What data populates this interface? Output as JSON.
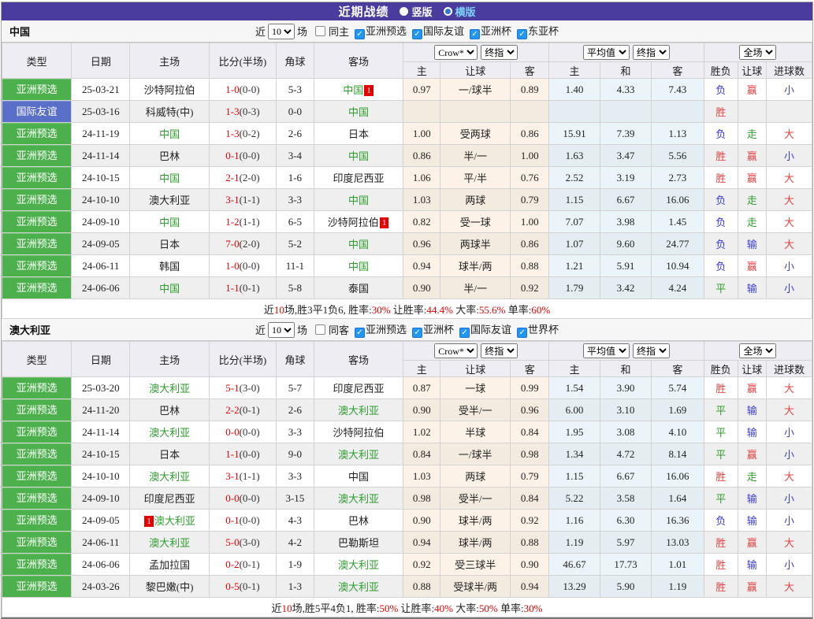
{
  "title_bar": {
    "title": "近期战绩",
    "radios": [
      {
        "label": "竖版",
        "selected": true,
        "label_color": "#ffffff"
      },
      {
        "label": "横版",
        "selected": false,
        "label_color": "#7fd2ff"
      }
    ]
  },
  "columns": {
    "type": "类型",
    "date": "日期",
    "home": "主场",
    "score": "比分(半场)",
    "corner": "角球",
    "away": "客场",
    "crow_select": "Crow*",
    "final_select": "终指",
    "avg_select": "平均值",
    "full_select": "全场",
    "sub": {
      "home": "主",
      "handicap": "让球",
      "away": "客",
      "avg_home": "主",
      "draw": "和",
      "avg_away": "客",
      "result": "胜负",
      "handicap_result": "让球",
      "goals": "进球数"
    }
  },
  "filter": {
    "near": "近",
    "count": "10",
    "games": "场"
  },
  "colors": {
    "accent_purple": "#4a3c9e",
    "badge_green": "#4cb14c",
    "badge_blue": "#5a6fc8",
    "team_green": "#2e9e2e",
    "score_red": "#e60000",
    "checkbox_blue": "#2196f3",
    "crow_col_bg": "#fcf2e7",
    "avg_col_bg": "#eaf4f9"
  },
  "sections": [
    {
      "name": "中国",
      "same_label": "同主",
      "checkboxes": [
        {
          "label": "亚洲预选",
          "checked": true
        },
        {
          "label": "国际友谊",
          "checked": true
        },
        {
          "label": "亚洲杯",
          "checked": true
        },
        {
          "label": "东亚杯",
          "checked": true
        }
      ],
      "rows": [
        {
          "type": {
            "label": "亚洲预选",
            "cls": "green"
          },
          "date": "25-03-21",
          "home": {
            "name": "沙特阿拉伯"
          },
          "score": "1-0",
          "half": "(0-0)",
          "corner": "5-3",
          "away": {
            "name": "中国",
            "green": true,
            "badge": "1",
            "badge_pos": "after"
          },
          "crow": [
            "0.97",
            "一/球半",
            "0.89"
          ],
          "avg": [
            "1.40",
            "4.33",
            "7.43"
          ],
          "result": [
            {
              "t": "负",
              "c": "blue"
            },
            {
              "t": "赢",
              "c": "red"
            },
            {
              "t": "小",
              "c": "blue"
            }
          ]
        },
        {
          "type": {
            "label": "国际友谊",
            "cls": "blue"
          },
          "date": "25-03-16",
          "home": {
            "name": "科威特(中)"
          },
          "score": "1-3",
          "half": "(0-3)",
          "corner": "0-0",
          "away": {
            "name": "中国",
            "green": true
          },
          "crow": [
            "",
            "",
            ""
          ],
          "avg": [
            "",
            "",
            ""
          ],
          "result": [
            {
              "t": "胜",
              "c": "red"
            },
            {
              "t": "",
              "c": ""
            },
            {
              "t": "",
              "c": ""
            }
          ]
        },
        {
          "type": {
            "label": "亚洲预选",
            "cls": "green"
          },
          "date": "24-11-19",
          "home": {
            "name": "中国",
            "green": true
          },
          "score": "1-3",
          "half": "(0-2)",
          "corner": "2-6",
          "away": {
            "name": "日本"
          },
          "crow": [
            "1.00",
            "受两球",
            "0.86"
          ],
          "avg": [
            "15.91",
            "7.39",
            "1.13"
          ],
          "result": [
            {
              "t": "负",
              "c": "blue"
            },
            {
              "t": "走",
              "c": "green"
            },
            {
              "t": "大",
              "c": "red"
            }
          ]
        },
        {
          "type": {
            "label": "亚洲预选",
            "cls": "green"
          },
          "date": "24-11-14",
          "home": {
            "name": "巴林"
          },
          "score": "0-1",
          "half": "(0-0)",
          "corner": "3-4",
          "away": {
            "name": "中国",
            "green": true
          },
          "crow": [
            "0.86",
            "半/一",
            "1.00"
          ],
          "avg": [
            "1.63",
            "3.47",
            "5.56"
          ],
          "result": [
            {
              "t": "胜",
              "c": "red"
            },
            {
              "t": "赢",
              "c": "red"
            },
            {
              "t": "小",
              "c": "blue"
            }
          ]
        },
        {
          "type": {
            "label": "亚洲预选",
            "cls": "green"
          },
          "date": "24-10-15",
          "home": {
            "name": "中国",
            "green": true
          },
          "score": "2-1",
          "half": "(2-0)",
          "corner": "1-6",
          "away": {
            "name": "印度尼西亚"
          },
          "crow": [
            "1.06",
            "平/半",
            "0.76"
          ],
          "avg": [
            "2.52",
            "3.19",
            "2.73"
          ],
          "result": [
            {
              "t": "胜",
              "c": "red"
            },
            {
              "t": "赢",
              "c": "red"
            },
            {
              "t": "大",
              "c": "red"
            }
          ]
        },
        {
          "type": {
            "label": "亚洲预选",
            "cls": "green"
          },
          "date": "24-10-10",
          "home": {
            "name": "澳大利亚"
          },
          "score": "3-1",
          "half": "(1-1)",
          "corner": "3-3",
          "away": {
            "name": "中国",
            "green": true
          },
          "crow": [
            "1.03",
            "两球",
            "0.79"
          ],
          "avg": [
            "1.15",
            "6.67",
            "16.06"
          ],
          "result": [
            {
              "t": "负",
              "c": "blue"
            },
            {
              "t": "走",
              "c": "green"
            },
            {
              "t": "大",
              "c": "red"
            }
          ]
        },
        {
          "type": {
            "label": "亚洲预选",
            "cls": "green"
          },
          "date": "24-09-10",
          "home": {
            "name": "中国",
            "green": true
          },
          "score": "1-2",
          "half": "(1-1)",
          "corner": "6-5",
          "away": {
            "name": "沙特阿拉伯",
            "badge": "1",
            "badge_pos": "after"
          },
          "crow": [
            "0.82",
            "受一球",
            "1.00"
          ],
          "avg": [
            "7.07",
            "3.98",
            "1.45"
          ],
          "result": [
            {
              "t": "负",
              "c": "blue"
            },
            {
              "t": "走",
              "c": "green"
            },
            {
              "t": "大",
              "c": "red"
            }
          ]
        },
        {
          "type": {
            "label": "亚洲预选",
            "cls": "green"
          },
          "date": "24-09-05",
          "home": {
            "name": "日本"
          },
          "score": "7-0",
          "half": "(2-0)",
          "corner": "5-2",
          "away": {
            "name": "中国",
            "green": true
          },
          "crow": [
            "0.96",
            "两球半",
            "0.86"
          ],
          "avg": [
            "1.07",
            "9.60",
            "24.77"
          ],
          "result": [
            {
              "t": "负",
              "c": "blue"
            },
            {
              "t": "输",
              "c": "blue"
            },
            {
              "t": "大",
              "c": "red"
            }
          ]
        },
        {
          "type": {
            "label": "亚洲预选",
            "cls": "green"
          },
          "date": "24-06-11",
          "home": {
            "name": "韩国"
          },
          "score": "1-0",
          "half": "(0-0)",
          "corner": "11-1",
          "away": {
            "name": "中国",
            "green": true
          },
          "crow": [
            "0.94",
            "球半/两",
            "0.88"
          ],
          "avg": [
            "1.21",
            "5.91",
            "10.94"
          ],
          "result": [
            {
              "t": "负",
              "c": "blue"
            },
            {
              "t": "赢",
              "c": "red"
            },
            {
              "t": "小",
              "c": "blue"
            }
          ]
        },
        {
          "type": {
            "label": "亚洲预选",
            "cls": "green"
          },
          "date": "24-06-06",
          "home": {
            "name": "中国",
            "green": true
          },
          "score": "1-1",
          "half": "(0-1)",
          "corner": "5-8",
          "away": {
            "name": "泰国"
          },
          "crow": [
            "0.90",
            "半/一",
            "0.92"
          ],
          "avg": [
            "1.79",
            "3.42",
            "4.24"
          ],
          "result": [
            {
              "t": "平",
              "c": "green"
            },
            {
              "t": "输",
              "c": "blue"
            },
            {
              "t": "小",
              "c": "blue"
            }
          ]
        }
      ],
      "summary": [
        {
          "t": "近",
          "c": "dark"
        },
        {
          "t": "10",
          "c": "red"
        },
        {
          "t": "场,胜3平1负6, 胜率:",
          "c": "dark"
        },
        {
          "t": "30%",
          "c": "red"
        },
        {
          "t": " 让胜率:",
          "c": "dark"
        },
        {
          "t": "44.4%",
          "c": "red"
        },
        {
          "t": " 大率:",
          "c": "dark"
        },
        {
          "t": "55.6%",
          "c": "red"
        },
        {
          "t": " 单率:",
          "c": "dark"
        },
        {
          "t": "60%",
          "c": "red"
        }
      ]
    },
    {
      "name": "澳大利亚",
      "same_label": "同客",
      "checkboxes": [
        {
          "label": "亚洲预选",
          "checked": true
        },
        {
          "label": "亚洲杯",
          "checked": true
        },
        {
          "label": "国际友谊",
          "checked": true
        },
        {
          "label": "世界杯",
          "checked": true
        }
      ],
      "rows": [
        {
          "type": {
            "label": "亚洲预选",
            "cls": "green"
          },
          "date": "25-03-20",
          "home": {
            "name": "澳大利亚",
            "green": true
          },
          "score": "5-1",
          "half": "(3-0)",
          "corner": "5-7",
          "away": {
            "name": "印度尼西亚"
          },
          "crow": [
            "0.87",
            "一球",
            "0.99"
          ],
          "avg": [
            "1.54",
            "3.90",
            "5.74"
          ],
          "result": [
            {
              "t": "胜",
              "c": "red"
            },
            {
              "t": "赢",
              "c": "red"
            },
            {
              "t": "大",
              "c": "red"
            }
          ]
        },
        {
          "type": {
            "label": "亚洲预选",
            "cls": "green"
          },
          "date": "24-11-20",
          "home": {
            "name": "巴林"
          },
          "score": "2-2",
          "half": "(0-1)",
          "corner": "2-6",
          "away": {
            "name": "澳大利亚",
            "green": true
          },
          "crow": [
            "0.90",
            "受半/一",
            "0.96"
          ],
          "avg": [
            "6.00",
            "3.10",
            "1.69"
          ],
          "result": [
            {
              "t": "平",
              "c": "green"
            },
            {
              "t": "输",
              "c": "blue"
            },
            {
              "t": "大",
              "c": "red"
            }
          ]
        },
        {
          "type": {
            "label": "亚洲预选",
            "cls": "green"
          },
          "date": "24-11-14",
          "home": {
            "name": "澳大利亚",
            "green": true
          },
          "score": "0-0",
          "half": "(0-0)",
          "corner": "3-3",
          "away": {
            "name": "沙特阿拉伯"
          },
          "crow": [
            "1.02",
            "半球",
            "0.84"
          ],
          "avg": [
            "1.95",
            "3.08",
            "4.10"
          ],
          "result": [
            {
              "t": "平",
              "c": "green"
            },
            {
              "t": "输",
              "c": "blue"
            },
            {
              "t": "小",
              "c": "blue"
            }
          ]
        },
        {
          "type": {
            "label": "亚洲预选",
            "cls": "green"
          },
          "date": "24-10-15",
          "home": {
            "name": "日本"
          },
          "score": "1-1",
          "half": "(0-0)",
          "corner": "9-0",
          "away": {
            "name": "澳大利亚",
            "green": true
          },
          "crow": [
            "0.84",
            "一/球半",
            "0.98"
          ],
          "avg": [
            "1.34",
            "4.72",
            "8.14"
          ],
          "result": [
            {
              "t": "平",
              "c": "green"
            },
            {
              "t": "赢",
              "c": "red"
            },
            {
              "t": "小",
              "c": "blue"
            }
          ]
        },
        {
          "type": {
            "label": "亚洲预选",
            "cls": "green"
          },
          "date": "24-10-10",
          "home": {
            "name": "澳大利亚",
            "green": true
          },
          "score": "3-1",
          "half": "(1-1)",
          "corner": "3-3",
          "away": {
            "name": "中国"
          },
          "crow": [
            "1.03",
            "两球",
            "0.79"
          ],
          "avg": [
            "1.15",
            "6.67",
            "16.06"
          ],
          "result": [
            {
              "t": "胜",
              "c": "red"
            },
            {
              "t": "走",
              "c": "green"
            },
            {
              "t": "大",
              "c": "red"
            }
          ]
        },
        {
          "type": {
            "label": "亚洲预选",
            "cls": "green"
          },
          "date": "24-09-10",
          "home": {
            "name": "印度尼西亚"
          },
          "score": "0-0",
          "half": "(0-0)",
          "corner": "3-15",
          "away": {
            "name": "澳大利亚",
            "green": true
          },
          "crow": [
            "0.98",
            "受半/一",
            "0.84"
          ],
          "avg": [
            "5.22",
            "3.58",
            "1.64"
          ],
          "result": [
            {
              "t": "平",
              "c": "green"
            },
            {
              "t": "输",
              "c": "blue"
            },
            {
              "t": "小",
              "c": "blue"
            }
          ]
        },
        {
          "type": {
            "label": "亚洲预选",
            "cls": "green"
          },
          "date": "24-09-05",
          "home": {
            "name": "澳大利亚",
            "green": true,
            "badge": "1",
            "badge_pos": "before"
          },
          "score": "0-1",
          "half": "(0-0)",
          "corner": "4-3",
          "away": {
            "name": "巴林"
          },
          "crow": [
            "0.90",
            "球半/两",
            "0.92"
          ],
          "avg": [
            "1.16",
            "6.30",
            "16.36"
          ],
          "result": [
            {
              "t": "负",
              "c": "blue"
            },
            {
              "t": "输",
              "c": "blue"
            },
            {
              "t": "小",
              "c": "blue"
            }
          ]
        },
        {
          "type": {
            "label": "亚洲预选",
            "cls": "green"
          },
          "date": "24-06-11",
          "home": {
            "name": "澳大利亚",
            "green": true
          },
          "score": "5-0",
          "half": "(3-0)",
          "corner": "4-2",
          "away": {
            "name": "巴勒斯坦"
          },
          "crow": [
            "0.94",
            "球半/两",
            "0.88"
          ],
          "avg": [
            "1.19",
            "5.97",
            "13.03"
          ],
          "result": [
            {
              "t": "胜",
              "c": "red"
            },
            {
              "t": "赢",
              "c": "red"
            },
            {
              "t": "大",
              "c": "red"
            }
          ]
        },
        {
          "type": {
            "label": "亚洲预选",
            "cls": "green"
          },
          "date": "24-06-06",
          "home": {
            "name": "孟加拉国"
          },
          "score": "0-2",
          "half": "(0-1)",
          "corner": "1-9",
          "away": {
            "name": "澳大利亚",
            "green": true
          },
          "crow": [
            "0.92",
            "受三球半",
            "0.90"
          ],
          "avg": [
            "46.67",
            "17.73",
            "1.01"
          ],
          "result": [
            {
              "t": "胜",
              "c": "red"
            },
            {
              "t": "输",
              "c": "blue"
            },
            {
              "t": "小",
              "c": "blue"
            }
          ]
        },
        {
          "type": {
            "label": "亚洲预选",
            "cls": "green"
          },
          "date": "24-03-26",
          "home": {
            "name": "黎巴嫩(中)"
          },
          "score": "0-5",
          "half": "(0-1)",
          "corner": "1-3",
          "away": {
            "name": "澳大利亚",
            "green": true
          },
          "crow": [
            "0.88",
            "受球半/两",
            "0.94"
          ],
          "avg": [
            "13.29",
            "5.90",
            "1.19"
          ],
          "result": [
            {
              "t": "胜",
              "c": "red"
            },
            {
              "t": "赢",
              "c": "red"
            },
            {
              "t": "大",
              "c": "red"
            }
          ]
        }
      ],
      "summary": [
        {
          "t": "近",
          "c": "dark"
        },
        {
          "t": "10",
          "c": "red"
        },
        {
          "t": "场,胜5平4负1, 胜率:",
          "c": "dark"
        },
        {
          "t": "50%",
          "c": "red"
        },
        {
          "t": " 让胜率:",
          "c": "dark"
        },
        {
          "t": "40%",
          "c": "red"
        },
        {
          "t": " 大率:",
          "c": "dark"
        },
        {
          "t": "50%",
          "c": "red"
        },
        {
          "t": " 单率:",
          "c": "dark"
        },
        {
          "t": "30%",
          "c": "red"
        }
      ]
    }
  ]
}
